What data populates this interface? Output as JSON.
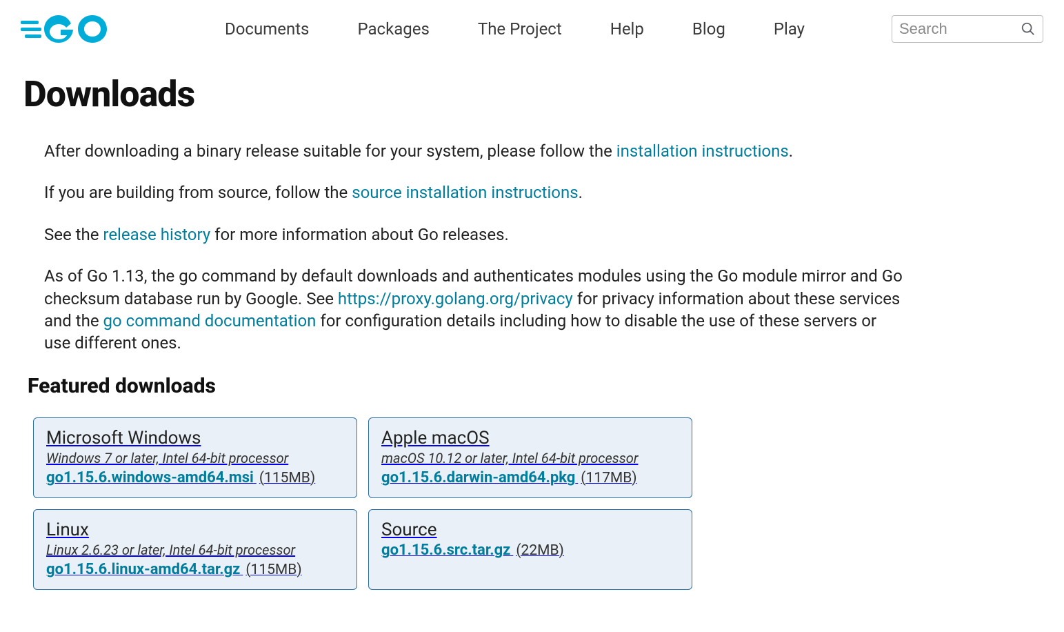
{
  "nav": {
    "items": [
      "Documents",
      "Packages",
      "The Project",
      "Help",
      "Blog",
      "Play"
    ]
  },
  "search": {
    "placeholder": "Search"
  },
  "page": {
    "title": "Downloads",
    "intro": {
      "p1a": "After downloading a binary release suitable for your system, please follow the ",
      "p1link": "installation instructions",
      "p1b": ".",
      "p2a": "If you are building from source, follow the ",
      "p2link": "source installation instructions",
      "p2b": ".",
      "p3a": "See the ",
      "p3link": "release history",
      "p3b": " for more information about Go releases.",
      "p4a": "As of Go 1.13, the go command by default downloads and authenticates modules using the Go module mirror and Go checksum database run by Google. See ",
      "p4link1": "https://proxy.golang.org/privacy",
      "p4b": " for privacy information about these services and the ",
      "p4link2": "go command documentation",
      "p4c": " for configuration details including how to disable the use of these servers or use different ones."
    },
    "featured_heading": "Featured downloads",
    "cards": [
      {
        "title": "Microsoft Windows",
        "req": "Windows 7 or later, Intel 64-bit processor",
        "file": "go1.15.6.windows-amd64.msi",
        "size": "(115MB)"
      },
      {
        "title": "Apple macOS",
        "req": "macOS 10.12 or later, Intel 64-bit processor",
        "file": "go1.15.6.darwin-amd64.pkg",
        "size": "(117MB)"
      },
      {
        "title": "Linux",
        "req": "Linux 2.6.23 or later, Intel 64-bit processor",
        "file": "go1.15.6.linux-amd64.tar.gz",
        "size": "(115MB)"
      },
      {
        "title": "Source",
        "req": "",
        "file": "go1.15.6.src.tar.gz",
        "size": "(22MB)"
      }
    ]
  }
}
